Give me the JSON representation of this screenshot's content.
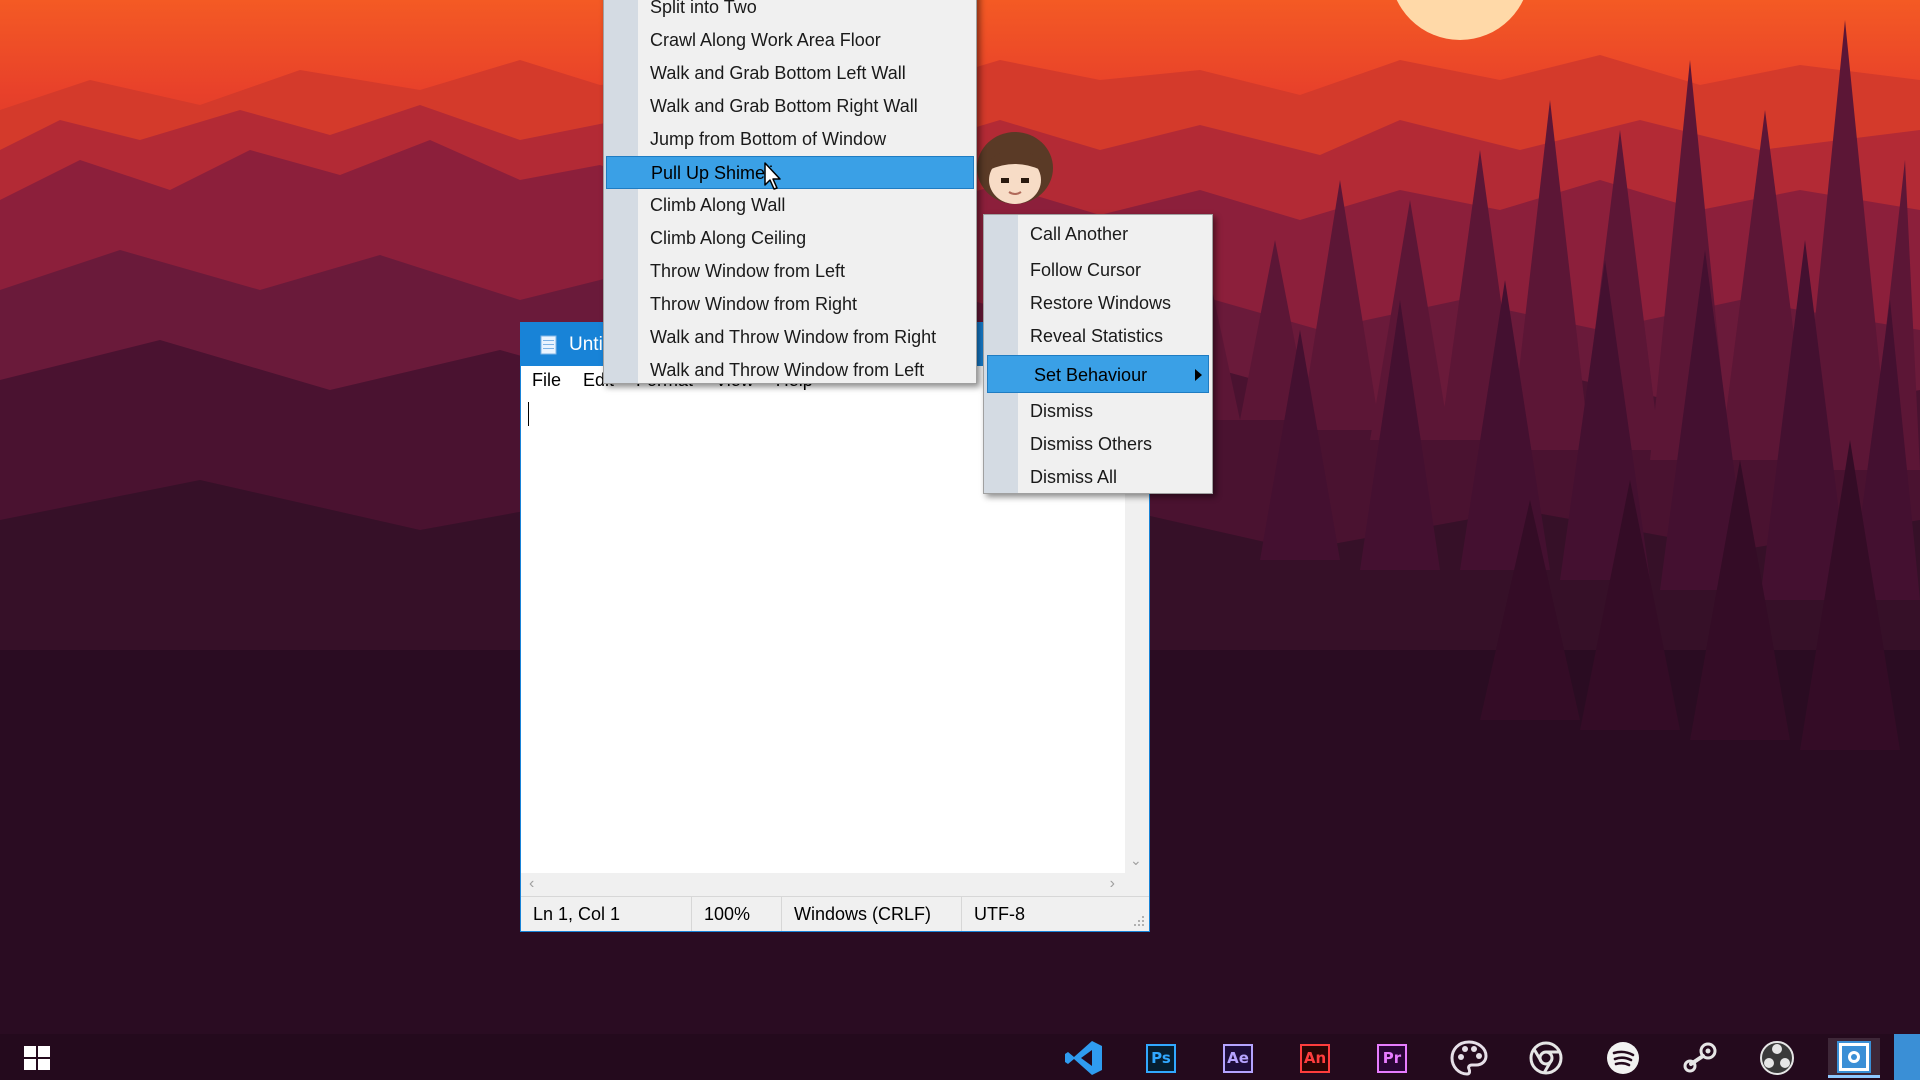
{
  "notepad": {
    "title": "Unti",
    "menu": [
      "File",
      "Edit",
      "Format",
      "View",
      "Help"
    ],
    "status": {
      "position": "Ln 1, Col 1",
      "zoom": "100%",
      "line_ending": "Windows (CRLF)",
      "encoding": "UTF-8"
    }
  },
  "behaviour_menu": {
    "items": [
      "Split into Two",
      "Crawl Along Work Area Floor",
      "Walk and Grab Bottom Left Wall",
      "Walk and Grab Bottom Right Wall",
      "Jump from Bottom of Window",
      "Pull Up Shimeji",
      "Climb Along Wall",
      "Climb Along Ceiling",
      "Throw Window from Left",
      "Throw Window from Right",
      "Walk and Throw Window from Right",
      "Walk and Throw Window from Left"
    ],
    "highlighted": "Pull Up Shimeji"
  },
  "context_menu": {
    "items": [
      "Call Another",
      "Follow Cursor",
      "Restore Windows",
      "Reveal Statistics",
      "Set Behaviour",
      "Dismiss",
      "Dismiss Others",
      "Dismiss All"
    ],
    "highlighted": "Set Behaviour"
  },
  "taskbar": {
    "icons": [
      {
        "name": "windows-start-icon"
      },
      {
        "name": "vscode-icon",
        "color": "#2f9cf0"
      },
      {
        "name": "photoshop-icon",
        "label": "Ps",
        "color": "#31a8ff",
        "bg": "#061e30"
      },
      {
        "name": "after-effects-icon",
        "label": "Ae",
        "color": "#b5a4ff",
        "bg": "#1d0d3a"
      },
      {
        "name": "animate-icon",
        "label": "An",
        "color": "#ff3d3d",
        "bg": "#2a0505"
      },
      {
        "name": "premiere-icon",
        "label": "Pr",
        "color": "#e77cff",
        "bg": "#2a0636"
      },
      {
        "name": "palette-icon"
      },
      {
        "name": "chrome-icon"
      },
      {
        "name": "spotify-icon"
      },
      {
        "name": "steam-icon"
      },
      {
        "name": "obs-icon"
      },
      {
        "name": "shimeji-app-icon"
      }
    ]
  },
  "colors": {
    "accent": "#1883d7",
    "menu_highlight": "#3aa0e6",
    "taskbar": "#240a1d"
  }
}
